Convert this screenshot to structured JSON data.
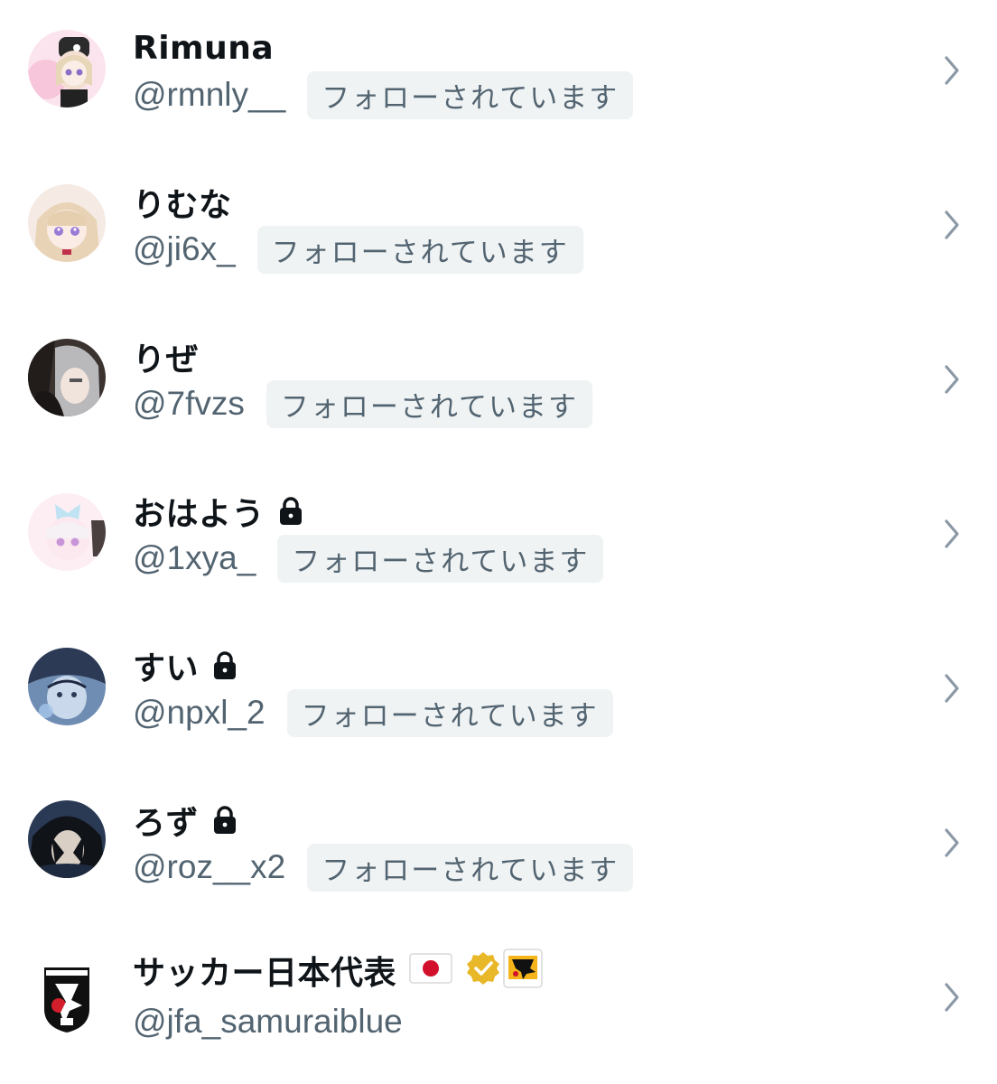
{
  "users": [
    {
      "name": "Rimuna",
      "handle": "@rmnly__",
      "follow_badge": "フォローされています",
      "locked": false,
      "avatar": "avatar-rimuna"
    },
    {
      "name": "りむな",
      "handle": "@ji6x_",
      "follow_badge": "フォローされています",
      "locked": false,
      "avatar": "avatar-rimuna-hiragana"
    },
    {
      "name": "りぜ",
      "handle": "@7fvzs",
      "follow_badge": "フォローされています",
      "locked": false,
      "avatar": "avatar-rize"
    },
    {
      "name": "おはよう",
      "handle": "@1xya_",
      "follow_badge": "フォローされています",
      "locked": true,
      "avatar": "avatar-ohayou"
    },
    {
      "name": "すい",
      "handle": "@npxl_2",
      "follow_badge": "フォローされています",
      "locked": true,
      "avatar": "avatar-sui"
    },
    {
      "name": "ろず",
      "handle": "@roz__x2",
      "follow_badge": "フォローされています",
      "locked": true,
      "avatar": "avatar-roz"
    },
    {
      "name": "サッカー日本代表",
      "handle": "@jfa_samuraiblue",
      "locked": false,
      "avatar": "avatar-jfa",
      "flag_icon": "japan-flag-icon",
      "verified_icon": "gold-verified-badge-icon",
      "affiliate_icon": "jfa-affiliate-icon"
    }
  ],
  "icons": {
    "lock": "lock-icon",
    "chevron": "chevron-right-icon"
  },
  "colors": {
    "name": "#0f1419",
    "secondary": "#536471",
    "badge_bg": "#eff3f4",
    "chevron": "#8b98a5",
    "verified_gold": "#e8b829"
  }
}
